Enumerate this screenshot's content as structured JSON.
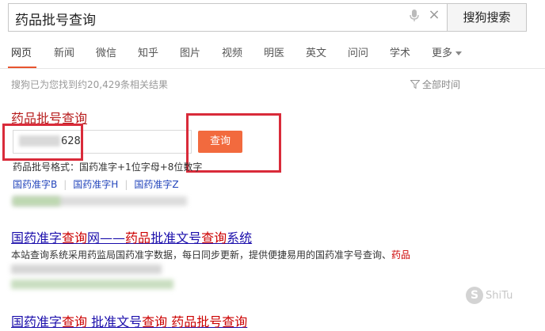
{
  "search": {
    "query": "药品批号查询",
    "button_label": "搜狗搜索",
    "clear_glyph": "×"
  },
  "tabs": [
    {
      "label": "网页"
    },
    {
      "label": "新闻"
    },
    {
      "label": "微信"
    },
    {
      "label": "知乎"
    },
    {
      "label": "图片"
    },
    {
      "label": "视频"
    },
    {
      "label": "明医"
    },
    {
      "label": "英文"
    },
    {
      "label": "问问"
    },
    {
      "label": "学术"
    },
    {
      "label": "更多"
    }
  ],
  "result_count": "搜狗已为您找到约20,429条相关结果",
  "filter_label": "全部时间",
  "result1": {
    "title": "药品批号查询",
    "input_value": "628",
    "query_button": "查询",
    "format_line": "药品批号格式：国药准字+1位字母+8位数字",
    "links": [
      "国药准字B",
      "国药准字H",
      "国药准字Z"
    ]
  },
  "result2": {
    "title_parts": [
      "国药准字",
      "查询",
      "网——",
      "药品",
      "批准文号",
      "查询",
      "系统"
    ],
    "desc_parts": [
      "本站查询系统采用药监局国药准字数据，每日同步更新，提供便捷易用的国药准字号查询、",
      "药品"
    ]
  },
  "result3": {
    "title_parts": [
      "国药准字",
      "查询",
      " 批准文号",
      "查询",
      " ",
      "药品批号查询"
    ]
  },
  "watermark": {
    "logo": "S",
    "text": "ShiTu"
  },
  "colors": {
    "accent": "#e8542f",
    "query_button": "#f26a3e",
    "highlight_box": "#d92b3a",
    "link": "#1a0dab"
  }
}
